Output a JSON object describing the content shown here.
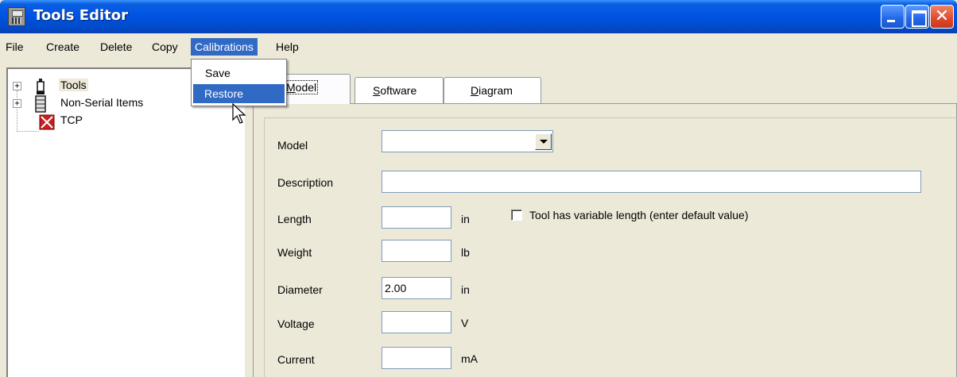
{
  "window": {
    "title": "Tools Editor"
  },
  "menu": {
    "items": [
      "File",
      "Create",
      "Delete",
      "Copy",
      "Calibrations",
      "Help"
    ],
    "active": "Calibrations",
    "dropdown": [
      "Save",
      "Restore"
    ],
    "highlighted": "Restore"
  },
  "tree": {
    "items": [
      {
        "label": "Tools",
        "icon": "tool-icon",
        "expandable": true,
        "toggle": "+"
      },
      {
        "label": "Non-Serial Items",
        "icon": "non-serial-icon",
        "expandable": true,
        "toggle": "+"
      },
      {
        "label": "TCP",
        "icon": "tcp-icon",
        "expandable": false
      }
    ]
  },
  "tabs": [
    {
      "label": "Model",
      "mnemonic": "M",
      "rest": "odel",
      "active": true
    },
    {
      "label": "Software",
      "mnemonic": "S",
      "rest": "oftware",
      "active": false
    },
    {
      "label": "Diagram",
      "mnemonic": "D",
      "rest": "iagram",
      "active": false
    }
  ],
  "form": {
    "model_label": "Model",
    "model_value": "",
    "description_label": "Description",
    "description_value": "",
    "length_label": "Length",
    "length_value": "",
    "length_unit": "in",
    "variable_length_checkbox": "Tool has variable length (enter default value)",
    "variable_length_checked": false,
    "weight_label": "Weight",
    "weight_value": "",
    "weight_unit": "lb",
    "diameter_label": "Diameter",
    "diameter_value": "2.00",
    "diameter_unit": "in",
    "voltage_label": "Voltage",
    "voltage_value": "",
    "voltage_unit": "V",
    "current_label": "Current",
    "current_value": "",
    "current_unit": "mA"
  },
  "colors": {
    "titlebar": "#0054e3",
    "menu_highlight": "#316ac5",
    "window_bg": "#ece9d8",
    "close_button": "#e0482a"
  }
}
